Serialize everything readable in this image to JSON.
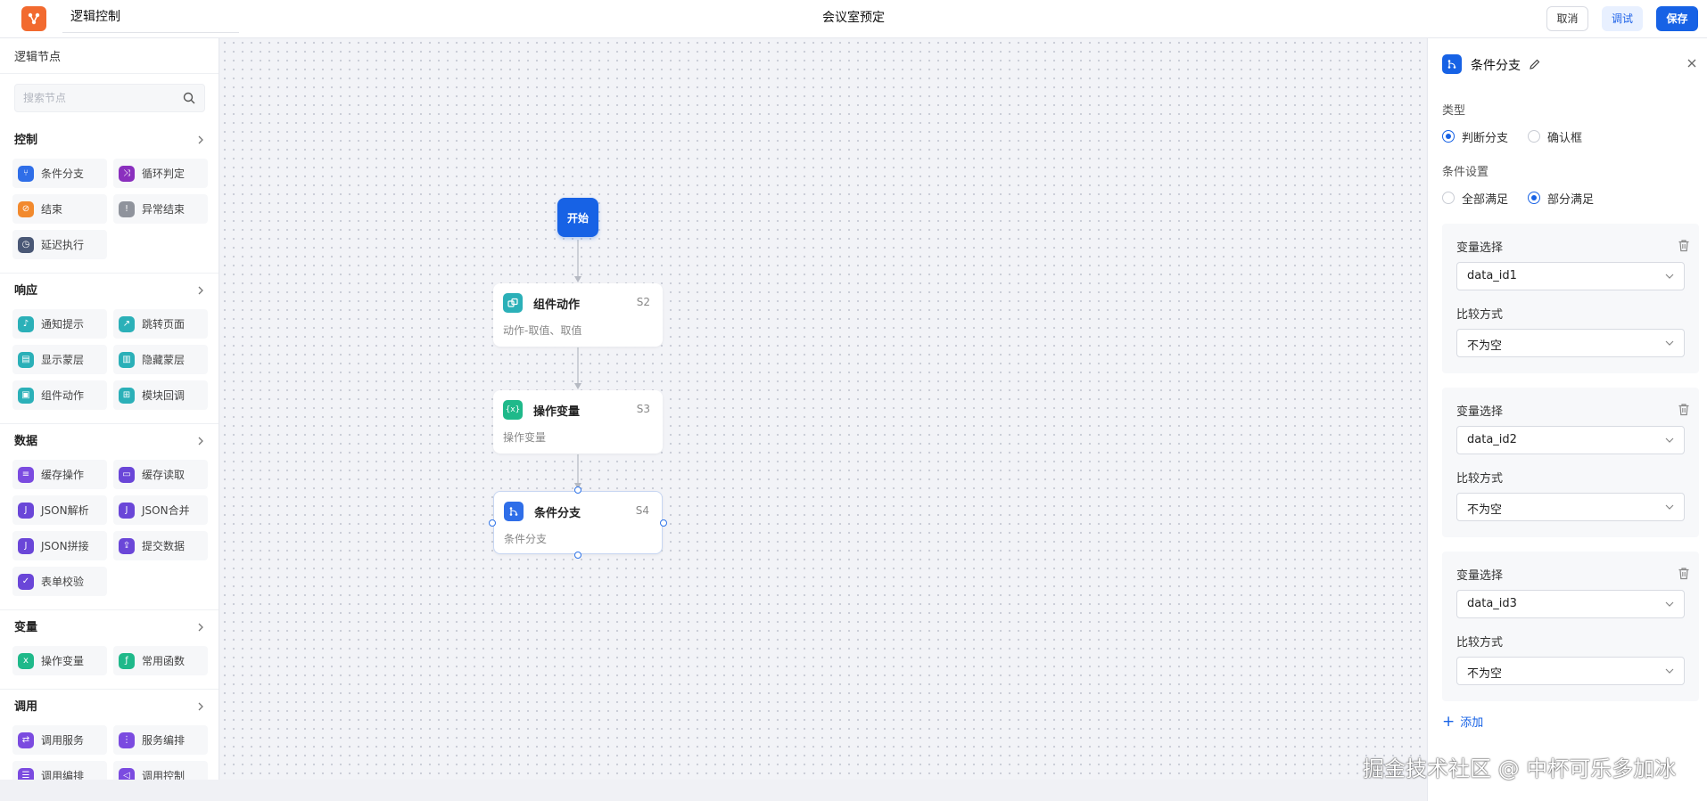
{
  "topbar": {
    "app_title": "逻辑控制",
    "page_title": "会议室预定",
    "cancel_label": "取消",
    "debug_label": "调试",
    "save_label": "保存"
  },
  "left_panel": {
    "title": "逻辑节点",
    "search_placeholder": "搜索节点",
    "categories": [
      {
        "label": "控制",
        "items": [
          {
            "label": "条件分支",
            "icon": "branch-icon",
            "color": "#2f6ee8"
          },
          {
            "label": "循环判定",
            "icon": "shuffle-icon",
            "color": "#8a2fbe"
          },
          {
            "label": "结束",
            "icon": "stop-icon",
            "color": "#f28a2e"
          },
          {
            "label": "异常结束",
            "icon": "alert-icon",
            "color": "#8f939c"
          },
          {
            "label": "延迟执行",
            "icon": "clock-icon",
            "color": "#4a5876"
          }
        ]
      },
      {
        "label": "响应",
        "items": [
          {
            "label": "通知提示",
            "icon": "bell-icon",
            "color": "#2bb0b8"
          },
          {
            "label": "跳转页面",
            "icon": "external-link-icon",
            "color": "#2bb0b8"
          },
          {
            "label": "显示蒙层",
            "icon": "layer-show-icon",
            "color": "#2bb0b8"
          },
          {
            "label": "隐藏蒙层",
            "icon": "layer-hide-icon",
            "color": "#2bb0b8"
          },
          {
            "label": "组件动作",
            "icon": "component-icon",
            "color": "#2bb0b8"
          },
          {
            "label": "模块回调",
            "icon": "module-icon",
            "color": "#2bb0b8"
          }
        ]
      },
      {
        "label": "数据",
        "items": [
          {
            "label": "缓存操作",
            "icon": "cache-icon",
            "color": "#7b4be0"
          },
          {
            "label": "缓存读取",
            "icon": "save-icon",
            "color": "#6a46d8"
          },
          {
            "label": "JSON解析",
            "icon": "json-parse-icon",
            "color": "#6a46d8"
          },
          {
            "label": "JSON合并",
            "icon": "json-merge-icon",
            "color": "#6a46d8"
          },
          {
            "label": "JSON拼接",
            "icon": "json-concat-icon",
            "color": "#6a46d8"
          },
          {
            "label": "提交数据",
            "icon": "submit-icon",
            "color": "#6a46d8"
          },
          {
            "label": "表单校验",
            "icon": "form-check-icon",
            "color": "#6a46d8"
          }
        ]
      },
      {
        "label": "变量",
        "items": [
          {
            "label": "操作变量",
            "icon": "variable-icon",
            "color": "#1fb98a"
          },
          {
            "label": "常用函数",
            "icon": "function-icon",
            "color": "#1fb98a"
          }
        ]
      },
      {
        "label": "调用",
        "items": [
          {
            "label": "调用服务",
            "icon": "service-icon",
            "color": "#7b4be0"
          },
          {
            "label": "服务编排",
            "icon": "orchestrate-icon",
            "color": "#7b4be0"
          },
          {
            "label": "调用编排",
            "icon": "call-orchestrate-icon",
            "color": "#7b4be0"
          },
          {
            "label": "调用控制",
            "icon": "call-control-icon",
            "color": "#7b4be0"
          }
        ]
      }
    ]
  },
  "canvas": {
    "start_label": "开始",
    "nodes": [
      {
        "title": "组件动作",
        "id": "S2",
        "desc": "动作-取值、取值",
        "icon": "component-icon",
        "color": "#2bb0b8"
      },
      {
        "title": "操作变量",
        "id": "S3",
        "desc": "操作变量",
        "icon": "variable-icon",
        "color": "#1fb98a"
      },
      {
        "title": "条件分支",
        "id": "S4",
        "desc": "条件分支",
        "icon": "branch-icon",
        "color": "#2f6ee8"
      }
    ]
  },
  "right_panel": {
    "title": "条件分支",
    "type_label": "类型",
    "type_options": [
      {
        "label": "判断分支",
        "checked": true
      },
      {
        "label": "确认框",
        "checked": false
      }
    ],
    "condition_label": "条件设置",
    "condition_options": [
      {
        "label": "全部满足",
        "checked": false
      },
      {
        "label": "部分满足",
        "checked": true
      }
    ],
    "conditions": [
      {
        "var_label": "变量选择",
        "var_value": "data_id1",
        "cmp_label": "比较方式",
        "cmp_value": "不为空"
      },
      {
        "var_label": "变量选择",
        "var_value": "data_id2",
        "cmp_label": "比较方式",
        "cmp_value": "不为空"
      },
      {
        "var_label": "变量选择",
        "var_value": "data_id3",
        "cmp_label": "比较方式",
        "cmp_value": "不为空"
      }
    ],
    "add_label": "添加"
  },
  "watermark": "掘金技术社区 @ 中杯可乐多加冰",
  "colors": {
    "accent": "#1762e5",
    "logo": "#f26a2f"
  }
}
